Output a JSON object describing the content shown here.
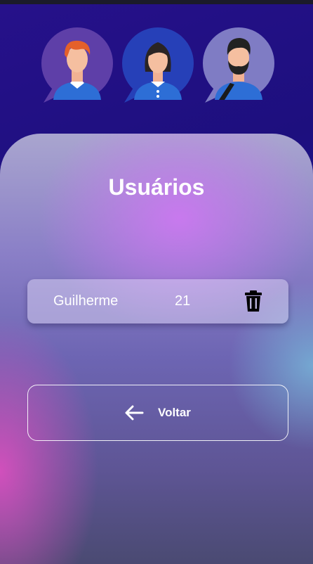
{
  "header": {
    "avatars": [
      {
        "icon": "male-user-icon",
        "bubble_color": "#5e3fa8"
      },
      {
        "icon": "female-user-icon",
        "bubble_color": "#2640b8"
      },
      {
        "icon": "bearded-male-user-icon",
        "bubble_color": "#7f7cc4"
      }
    ]
  },
  "title": "Usuários",
  "users": [
    {
      "name": "Guilherme",
      "age": "21",
      "action_icon": "trash-icon"
    }
  ],
  "back_button": {
    "label": "Voltar",
    "icon": "arrow-left-icon"
  },
  "colors": {
    "accent_blue": "#2350ff",
    "text": "#ffffff"
  }
}
